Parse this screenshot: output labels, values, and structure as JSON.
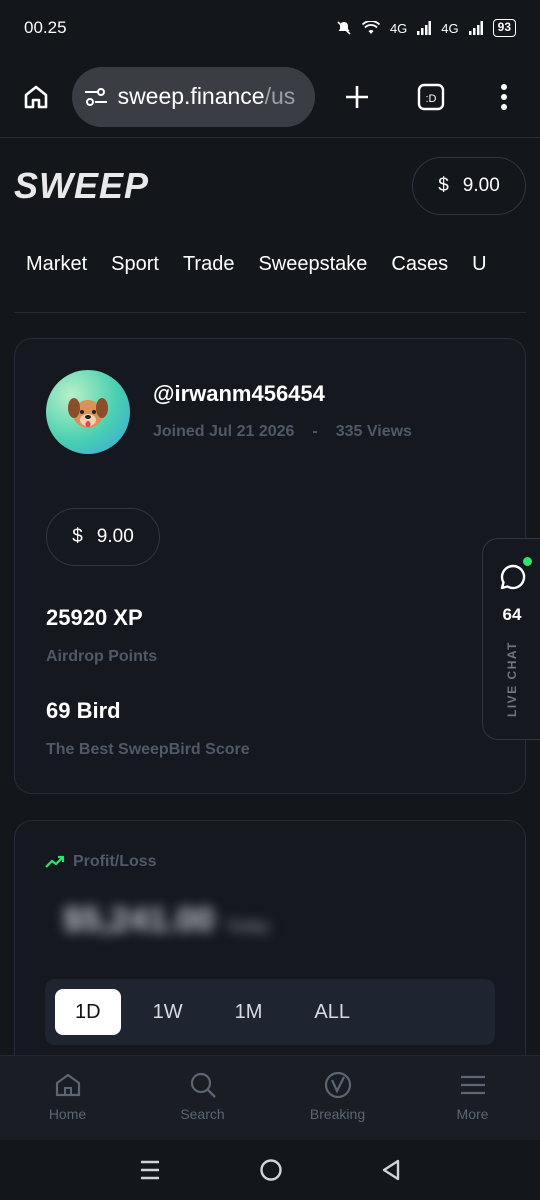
{
  "status_bar": {
    "time": "00.25",
    "network1": "4G",
    "network2": "4G",
    "battery": "93"
  },
  "browser": {
    "url_domain": "sweep.finance",
    "url_path": "/us"
  },
  "header": {
    "logo": "SWEEP",
    "balance_symbol": "$",
    "balance_value": "9.00"
  },
  "nav_tabs": [
    "Market",
    "Sport",
    "Trade",
    "Sweepstake",
    "Cases",
    "U"
  ],
  "profile": {
    "username": "@irwanm456454",
    "joined": "Joined Jul 21 2026",
    "separator": "-",
    "views": "335 Views",
    "balance_symbol": "$",
    "balance_value": "9.00",
    "xp_value": "25920 XP",
    "xp_label": "Airdrop Points",
    "bird_value": "69 Bird",
    "bird_label": "The Best SweepBird Score"
  },
  "live_chat": {
    "count": "64",
    "label": "LIVE CHAT"
  },
  "profit_loss": {
    "title": "Profit/Loss",
    "amount": "$5,241.00",
    "amount_suffix": "Today",
    "periods": [
      "1D",
      "1W",
      "1M",
      "ALL"
    ],
    "active_period": "1D"
  },
  "bottom_nav": [
    "Home",
    "Search",
    "Breaking",
    "More"
  ],
  "colors": {
    "background": "#13161b",
    "card": "#15181e",
    "accent_green": "#2ee36a",
    "muted": "#4f5968"
  }
}
